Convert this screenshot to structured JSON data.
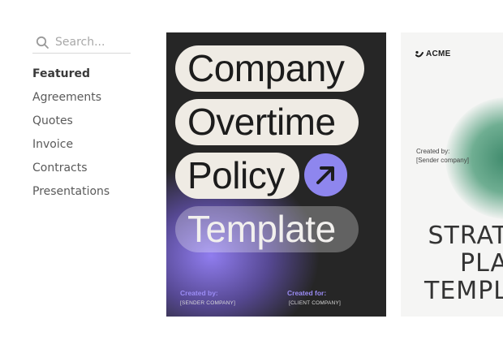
{
  "search": {
    "placeholder": "Search..."
  },
  "sidebar": {
    "items": [
      {
        "label": "Featured",
        "active": true
      },
      {
        "label": "Agreements"
      },
      {
        "label": "Quotes"
      },
      {
        "label": "Invoice"
      },
      {
        "label": "Contracts"
      },
      {
        "label": "Presentations"
      }
    ]
  },
  "cards": [
    {
      "title_words": [
        "Company",
        "Overtime",
        "Policy",
        "Template"
      ],
      "badge_icon": "arrow-up-right-icon",
      "created_by_label": "Created by:",
      "created_by_value": "[SENDER COMPANY]",
      "created_for_label": "Created for:",
      "created_for_value": "[CLIENT COMPANY]",
      "colors": {
        "background": "#262626",
        "pill": "#efebe4",
        "accent": "#8e86ee"
      }
    },
    {
      "logo_text": "ACME",
      "created_by_label": "Created by:",
      "created_by_value": "[Sender company]",
      "title_lines": [
        "STRAT",
        "PLA",
        "TEMPL"
      ],
      "colors": {
        "background": "#f5f5f4",
        "accent": "#3f8a6c"
      }
    }
  ]
}
